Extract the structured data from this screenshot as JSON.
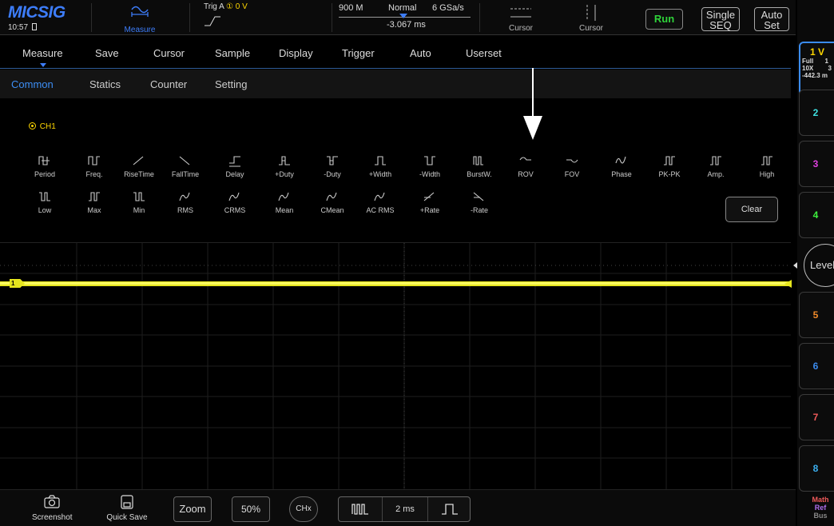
{
  "top": {
    "logo": "MICSIG",
    "clock": "10:57",
    "measure_label": "Measure",
    "trigger_text": "Trig A",
    "trigger_value": "① 0 V",
    "bandwidth": "900 M",
    "mode": "Normal",
    "sample_rate": "6 GSa/s",
    "offset": "-3.067 ms",
    "cursor1_label": "Cursor",
    "cursor2_label": "Cursor",
    "run_label": "Run",
    "single_label_1": "Single",
    "single_label_2": "SEQ",
    "auto_label_1": "Auto",
    "auto_label_2": "Set",
    "colors": {
      "brand": "#3d7dfa",
      "run": "#2fd33a",
      "ch1": "#ffd700"
    }
  },
  "menu": {
    "items": [
      "Measure",
      "Save",
      "Cursor",
      "Sample",
      "Display",
      "Trigger",
      "Auto",
      "Userset"
    ],
    "sub_items": [
      "Common",
      "Statics",
      "Counter",
      "Setting"
    ],
    "active_sub": "Common"
  },
  "panel": {
    "channel_label": "CH1",
    "measurements_row1": [
      "Period",
      "Freq.",
      "RiseTime",
      "FallTime",
      "Delay",
      "+Duty",
      "-Duty",
      "+Width",
      "-Width",
      "BurstW.",
      "ROV",
      "FOV",
      "Phase",
      "PK-PK",
      "Amp.",
      "High"
    ],
    "measurements_row2": [
      "Low",
      "Max",
      "Min",
      "RMS",
      "CRMS",
      "Mean",
      "CMean",
      "AC RMS",
      "+Rate",
      "-Rate"
    ],
    "clear_label": "Clear"
  },
  "right": {
    "ch1_scale": "1 V",
    "ch1_full": "Full",
    "ch1_bw": "1",
    "ch1_probe": "10X",
    "ch1_extra": "3",
    "ch1_offset": "-442.3 m",
    "channels": [
      "2",
      "3",
      "4",
      "5",
      "6",
      "7",
      "8"
    ],
    "channel_colors": [
      "#3ee0e0",
      "#e040e0",
      "#3ef03e",
      "#f08a2a",
      "#3b8cf0",
      "#f05a5a",
      "#3bb0f0"
    ],
    "level_label": "Level",
    "math": "Math",
    "ref": "Ref",
    "bus": "Bus"
  },
  "waveform": {
    "marker": "1"
  },
  "bottom": {
    "screenshot": "Screenshot",
    "quick_save": "Quick Save",
    "zoom": "Zoom",
    "percent": "50%",
    "chx": "CHx",
    "timebase": "2 ms"
  }
}
